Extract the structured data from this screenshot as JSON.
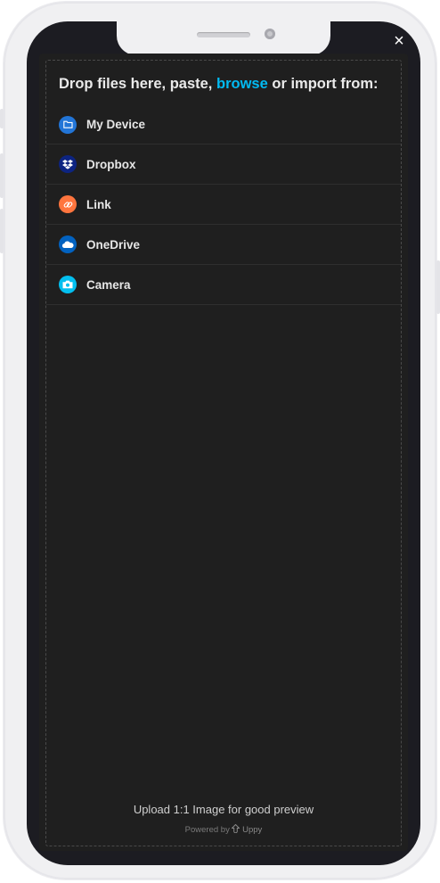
{
  "modal": {
    "close_label": "×",
    "title_before": "Drop files here, paste,",
    "browse_label": "browse",
    "title_after": "or import from:"
  },
  "providers": [
    {
      "label": "My Device",
      "icon": "folder-icon",
      "color": "#2275d7"
    },
    {
      "label": "Dropbox",
      "icon": "dropbox-icon",
      "color": "#0d2481"
    },
    {
      "label": "Link",
      "icon": "link-icon",
      "color": "#ff753e"
    },
    {
      "label": "OneDrive",
      "icon": "onedrive-icon",
      "color": "#0262c0"
    },
    {
      "label": "Camera",
      "icon": "camera-icon",
      "color": "#03bfef"
    }
  ],
  "footer": {
    "note": "Upload 1:1 Image for good preview",
    "powered_by": "Powered by",
    "brand": "Uppy"
  }
}
